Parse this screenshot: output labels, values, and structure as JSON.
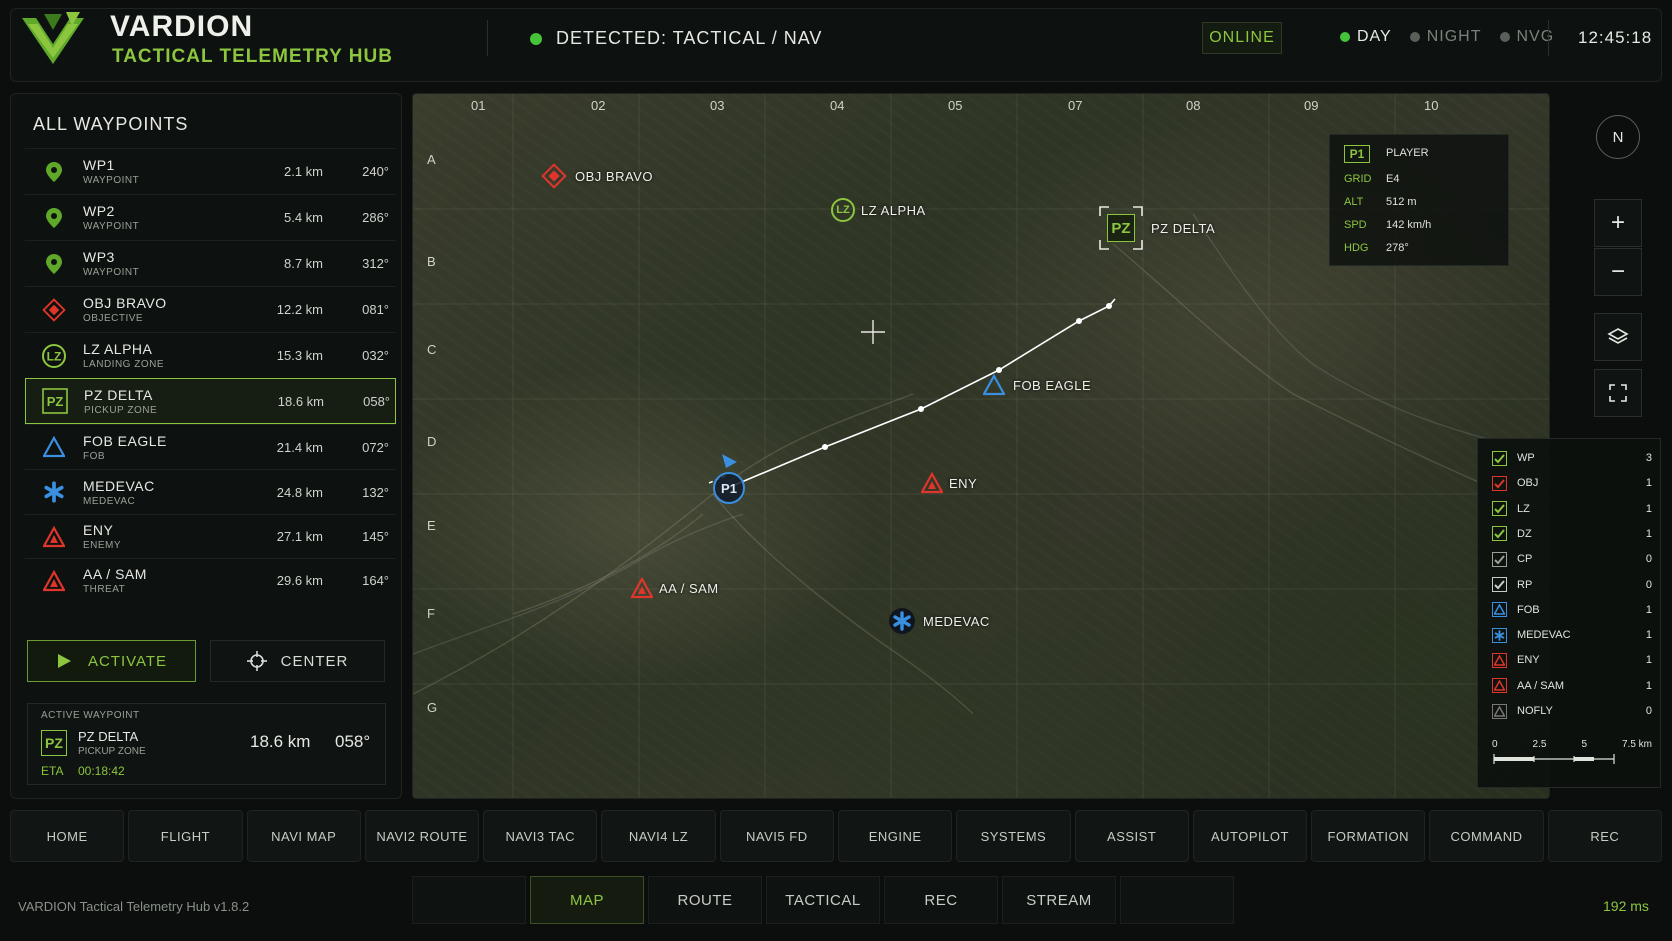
{
  "header": {
    "brand": "VARDION",
    "subtitle": "TACTICAL TELEMETRY HUB",
    "detected": "DETECTED: TACTICAL / NAV",
    "status": "ONLINE",
    "modes": [
      "DAY",
      "NIGHT",
      "NVG"
    ],
    "active_mode": "DAY",
    "clock": "12:45:18"
  },
  "waypoints": {
    "title": "ALL WAYPOINTS",
    "items": [
      {
        "name": "WP1",
        "type": "WAYPOINT",
        "dist": "2.1 km",
        "brg": "240°",
        "icon": "pin-icon"
      },
      {
        "name": "WP2",
        "type": "WAYPOINT",
        "dist": "5.4 km",
        "brg": "286°",
        "icon": "pin-icon"
      },
      {
        "name": "WP3",
        "type": "WAYPOINT",
        "dist": "8.7 km",
        "brg": "312°",
        "icon": "pin-icon"
      },
      {
        "name": "OBJ BRAVO",
        "type": "OBJECTIVE",
        "dist": "12.2 km",
        "brg": "081°",
        "icon": "objective-icon"
      },
      {
        "name": "LZ ALPHA",
        "type": "LANDING ZONE",
        "dist": "15.3 km",
        "brg": "032°",
        "icon": "lz-icon"
      },
      {
        "name": "PZ DELTA",
        "type": "PICKUP ZONE",
        "dist": "18.6 km",
        "brg": "058°",
        "icon": "pz-icon"
      },
      {
        "name": "FOB EAGLE",
        "type": "FOB",
        "dist": "21.4 km",
        "brg": "072°",
        "icon": "fob-icon"
      },
      {
        "name": "MEDEVAC",
        "type": "MEDEVAC",
        "dist": "24.8 km",
        "brg": "132°",
        "icon": "medevac-icon"
      },
      {
        "name": "ENY",
        "type": "ENEMY",
        "dist": "27.1 km",
        "brg": "145°",
        "icon": "enemy-icon"
      },
      {
        "name": "AA / SAM",
        "type": "THREAT",
        "dist": "29.6 km",
        "brg": "164°",
        "icon": "threat-icon"
      }
    ],
    "selected": "PZ DELTA",
    "activate_label": "ACTIVATE",
    "center_label": "CENTER"
  },
  "active_waypoint": {
    "label": "ACTIVE WAYPOINT",
    "code": "PZ",
    "name": "PZ DELTA",
    "type": "PICKUP ZONE",
    "dist": "18.6 km",
    "brg": "058°",
    "eta_label": "ETA",
    "eta": "00:18:42"
  },
  "map": {
    "columns": [
      "01",
      "02",
      "03",
      "04",
      "05",
      "07",
      "08",
      "09",
      "10"
    ],
    "rows": [
      "A",
      "B",
      "C",
      "D",
      "E",
      "F",
      "G"
    ],
    "markers": {
      "obj_bravo": "OBJ BRAVO",
      "lz_alpha": "LZ ALPHA",
      "pz_delta": "PZ DELTA",
      "fob_eagle": "FOB EAGLE",
      "eny": "ENY",
      "aa_sam": "AA / SAM",
      "medevac": "MEDEVAC",
      "player": "P1",
      "lz_code": "LZ",
      "pz_code": "PZ"
    }
  },
  "player_card": {
    "badge": "P1",
    "role": "PLAYER",
    "rows": [
      {
        "k": "GRID",
        "v": "E4"
      },
      {
        "k": "ALT",
        "v": "512 m"
      },
      {
        "k": "SPD",
        "v": "142 km/h"
      },
      {
        "k": "HDG",
        "v": "278°"
      }
    ]
  },
  "tools": {
    "compass": "N",
    "zoom_in": "+",
    "zoom_out": "−"
  },
  "legend": {
    "items": [
      {
        "name": "WP",
        "count": "3",
        "color": "#8cc63f",
        "box": "check"
      },
      {
        "name": "OBJ",
        "count": "1",
        "color": "#e0352b",
        "box": "check"
      },
      {
        "name": "LZ",
        "count": "1",
        "color": "#8cc63f",
        "box": "check"
      },
      {
        "name": "DZ",
        "count": "1",
        "color": "#8cc63f",
        "box": "check"
      },
      {
        "name": "CP",
        "count": "0",
        "color": "#9aa096",
        "box": "check"
      },
      {
        "name": "RP",
        "count": "0",
        "color": "#c8ccc4",
        "box": "check"
      },
      {
        "name": "FOB",
        "count": "1",
        "color": "#3a8fe0",
        "box": "tri"
      },
      {
        "name": "MEDEVAC",
        "count": "1",
        "color": "#3a8fe0",
        "box": "star"
      },
      {
        "name": "ENY",
        "count": "1",
        "color": "#e0352b",
        "box": "tri"
      },
      {
        "name": "AA / SAM",
        "count": "1",
        "color": "#e0352b",
        "box": "tri"
      },
      {
        "name": "NOFLY",
        "count": "0",
        "color": "#777",
        "box": "tri"
      }
    ],
    "scale": [
      "0",
      "2.5",
      "5",
      "7.5 km"
    ]
  },
  "nav": [
    "HOME",
    "FLIGHT",
    "NAVI MAP",
    "NAVI2 ROUTE",
    "NAVI3 TAC",
    "NAVI4 LZ",
    "NAVI5 FD",
    "ENGINE",
    "SYSTEMS",
    "ASSIST",
    "AUTOPILOT",
    "FORMATION",
    "COMMAND",
    "REC"
  ],
  "sub_nav": [
    "",
    "MAP",
    "ROUTE",
    "TACTICAL",
    "REC",
    "STREAM",
    ""
  ],
  "sub_nav_active": "MAP",
  "footer": {
    "version": "VARDION Tactical Telemetry Hub v1.8.2",
    "latency": "192 ms"
  },
  "colors": {
    "accent": "#8cc63f",
    "enemy": "#e0352b",
    "friendly": "#3a8fe0",
    "online": "#45c43a"
  }
}
